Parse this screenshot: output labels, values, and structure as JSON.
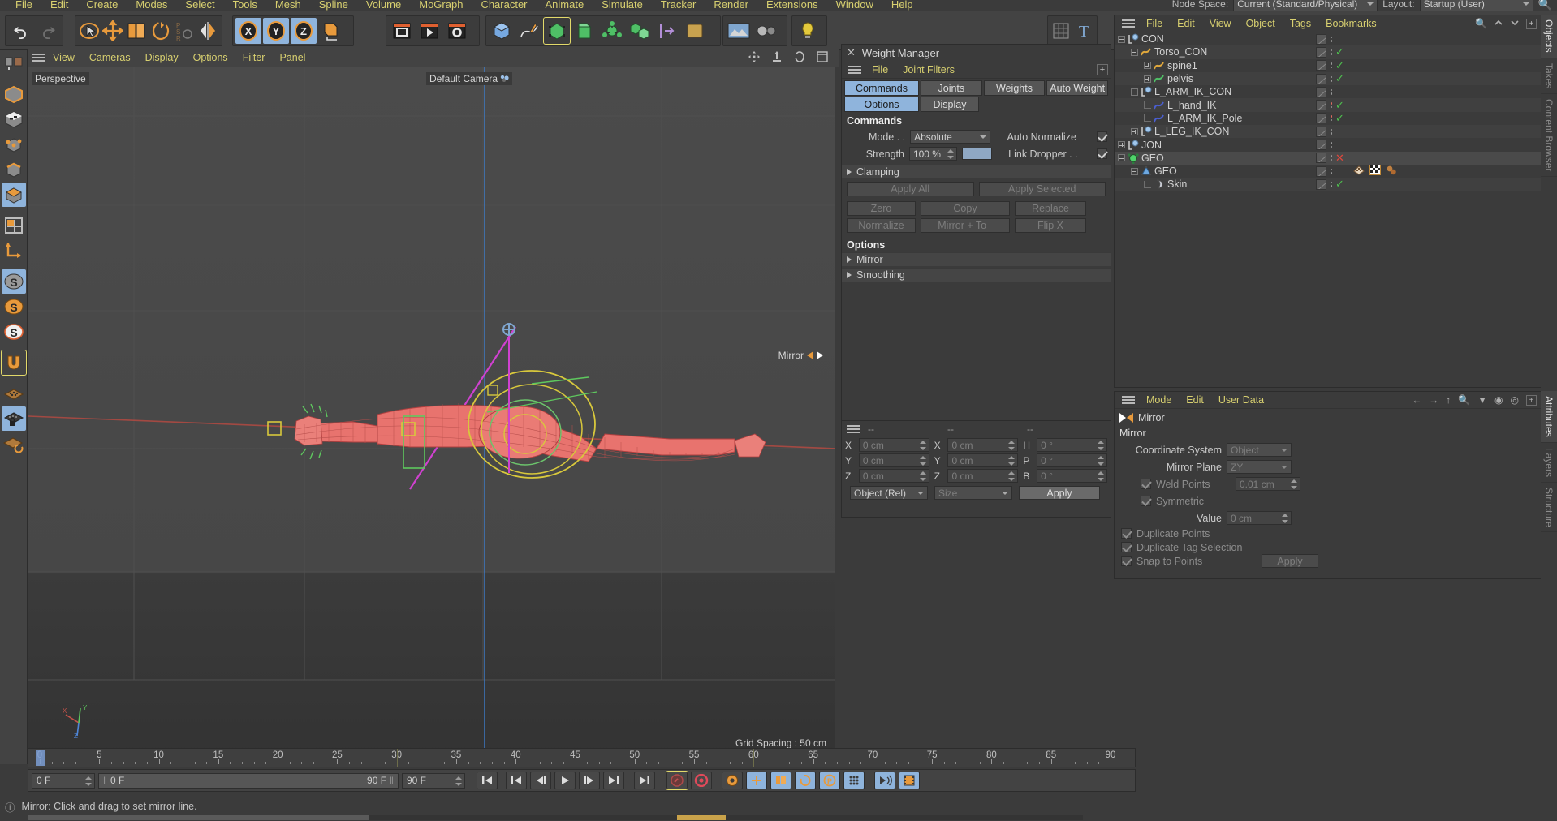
{
  "menubar": {
    "items": [
      "File",
      "Edit",
      "Create",
      "Modes",
      "Select",
      "Tools",
      "Mesh",
      "Spline",
      "Volume",
      "MoGraph",
      "Character",
      "Animate",
      "Simulate",
      "Tracker",
      "Render",
      "Extensions",
      "Window",
      "Help"
    ]
  },
  "topright": {
    "node_space_label": "Node Space:",
    "node_space_value": "Current (Standard/Physical)",
    "layout_label": "Layout:",
    "layout_value": "Startup (User)"
  },
  "viewport": {
    "menu": [
      "View",
      "Cameras",
      "Display",
      "Options",
      "Filter",
      "Panel"
    ],
    "perspective_label": "Perspective",
    "camera_label": "Default Camera",
    "grid_spacing": "Grid Spacing : 50 cm",
    "mirror_gizmo_label": "Mirror",
    "axis_x": "X",
    "axis_y": "Y",
    "axis_z": "Z"
  },
  "weight_manager": {
    "title": "Weight Manager",
    "menu": [
      "File",
      "Joint Filters"
    ],
    "tabs_row1": [
      {
        "label": "Commands",
        "active": true
      },
      {
        "label": "Joints",
        "active": false
      },
      {
        "label": "Weights",
        "active": false
      },
      {
        "label": "Auto Weight",
        "active": false
      }
    ],
    "tabs_row2": [
      {
        "label": "Options",
        "active": true
      },
      {
        "label": "Display",
        "active": false
      }
    ],
    "commands_header": "Commands",
    "mode_label": "Mode . .",
    "mode_value": "Absolute",
    "strength_label": "Strength",
    "strength_value": "100 %",
    "auto_normalize_label": "Auto Normalize",
    "auto_normalize_checked": true,
    "link_dropper_label": "Link Dropper . .",
    "link_dropper_checked": true,
    "clamping_label": "Clamping",
    "apply_all": "Apply All",
    "apply_selected": "Apply Selected",
    "zero": "Zero",
    "copy": "Copy",
    "replace": "Replace",
    "normalize": "Normalize",
    "mirror_to": "Mirror + To -",
    "flip_x": "Flip X",
    "options_header": "Options",
    "mirror_group": "Mirror",
    "smoothing_group": "Smoothing"
  },
  "coords": {
    "col_headers": [
      "--",
      "--",
      "--"
    ],
    "rows": [
      {
        "l1": "X",
        "v1": "0 cm",
        "l2": "X",
        "v2": "0 cm",
        "l3": "H",
        "v3": "0 °"
      },
      {
        "l1": "Y",
        "v1": "0 cm",
        "l2": "Y",
        "v2": "0 cm",
        "l3": "P",
        "v3": "0 °"
      },
      {
        "l1": "Z",
        "v1": "0 cm",
        "l2": "Z",
        "v2": "0 cm",
        "l3": "B",
        "v3": "0 °"
      }
    ],
    "object_rel": "Object (Rel)",
    "size": "Size",
    "apply": "Apply"
  },
  "object_manager": {
    "menu": [
      "File",
      "Edit",
      "View",
      "Object",
      "Tags",
      "Bookmarks"
    ],
    "tabs": [
      {
        "label": "Objects",
        "active": true
      },
      {
        "label": "Takes",
        "active": false
      },
      {
        "label": "Content Browser",
        "active": false
      }
    ],
    "rows": [
      {
        "name": "CON",
        "indent": 0,
        "icon": "null-object-icon",
        "expand": "minus",
        "check": "",
        "dot": "grey"
      },
      {
        "name": "Torso_CON",
        "indent": 1,
        "icon": "spline-orange-icon",
        "expand": "minus",
        "check": "ok",
        "dot": "grey"
      },
      {
        "name": "spine1",
        "indent": 2,
        "icon": "spline-orange-icon",
        "expand": "plus",
        "check": "ok",
        "dot": "grey"
      },
      {
        "name": "pelvis",
        "indent": 2,
        "icon": "spline-green-icon",
        "expand": "plus",
        "check": "ok",
        "dot": "grey"
      },
      {
        "name": "L_ARM_IK_CON",
        "indent": 1,
        "icon": "null-object-icon",
        "expand": "minus",
        "check": "",
        "dot": "grey"
      },
      {
        "name": "L_hand_IK",
        "indent": 2,
        "icon": "spline-blue-icon",
        "expand": "none",
        "check": "ok",
        "dot": "red"
      },
      {
        "name": "L_ARM_IK_Pole",
        "indent": 2,
        "icon": "spline-blue-icon",
        "expand": "none",
        "check": "ok",
        "dot": "red"
      },
      {
        "name": "L_LEG_IK_CON",
        "indent": 1,
        "icon": "null-object-icon",
        "expand": "plus",
        "check": "",
        "dot": "grey"
      },
      {
        "name": "JON",
        "indent": 0,
        "icon": "null-object-icon",
        "expand": "plus",
        "check": "",
        "dot": "grey"
      },
      {
        "name": "GEO",
        "indent": 0,
        "icon": "connect-green-icon",
        "expand": "minus",
        "check": "x",
        "dot": "grey",
        "selected": true
      },
      {
        "name": "GEO",
        "indent": 1,
        "icon": "polygon-blue-icon",
        "expand": "minus",
        "check": "",
        "dot": "grey",
        "tags": true
      },
      {
        "name": "Skin",
        "indent": 2,
        "icon": "skin-deformer-icon",
        "expand": "none",
        "check": "ok",
        "dot": "grey"
      }
    ]
  },
  "attributes": {
    "menu": [
      "Mode",
      "Edit",
      "User Data"
    ],
    "tabs": [
      {
        "label": "Attributes",
        "active": true
      },
      {
        "label": "Layers",
        "active": false
      },
      {
        "label": "Structure",
        "active": false
      }
    ],
    "tool_title": "Mirror",
    "section": "Mirror",
    "fields": [
      {
        "label": "Coordinate System",
        "value": "Object",
        "type": "select"
      },
      {
        "label": "Mirror Plane",
        "value": "ZY",
        "type": "select"
      }
    ],
    "weld_points_label": "Weld Points",
    "weld_points_checked": true,
    "weld_points_value": "0.01 cm",
    "symmetric_label": "Symmetric",
    "symmetric_checked": true,
    "value_label": "Value",
    "value_value": "0 cm",
    "duplicate_points_label": "Duplicate Points",
    "duplicate_points_checked": true,
    "duplicate_tag_label": "Duplicate Tag Selection",
    "duplicate_tag_checked": true,
    "snap_points_label": "Snap to Points",
    "snap_points_checked": true,
    "apply_label": "Apply"
  },
  "timeline": {
    "ticks": [
      0,
      5,
      10,
      15,
      20,
      25,
      30,
      35,
      40,
      45,
      50,
      55,
      60,
      65,
      70,
      75,
      80,
      85,
      90
    ],
    "current_frame": "0 F",
    "range_start": "0 F",
    "range_end": "90 F",
    "end_frame": "90 F",
    "playhead": 0
  },
  "statusbar": {
    "text": "Mirror: Click and drag to set mirror line."
  },
  "colors": {
    "accent_blue": "#8fb4dc",
    "accent_orange": "#e89a3c",
    "menu_yellow": "#d8d070",
    "panel_bg": "#3b3b3b",
    "ok_green": "#4ec24e",
    "err_red": "#e0473c",
    "mesh_red": "#e8736e"
  }
}
